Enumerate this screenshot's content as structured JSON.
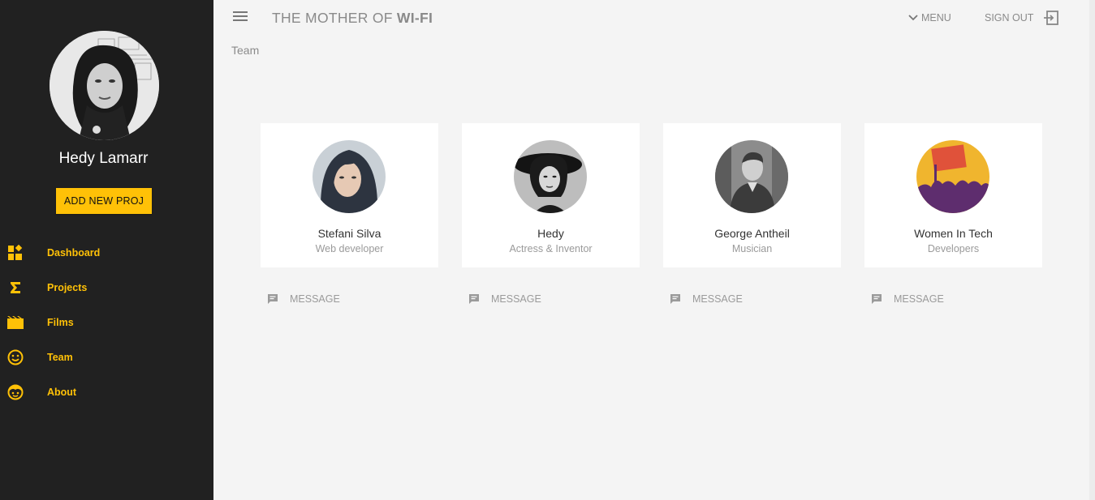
{
  "header": {
    "title_prefix": "THE MOTHER OF ",
    "title_bold": "WI-FI",
    "menu_label": "MENU",
    "signout_label": "SIGN OUT"
  },
  "sidebar": {
    "profile_name": "Hedy Lamarr",
    "add_button_label": "ADD NEW PROJ",
    "items": [
      {
        "label": "Dashboard",
        "icon": "dashboard-icon"
      },
      {
        "label": "Projects",
        "icon": "sigma-icon"
      },
      {
        "label": "Films",
        "icon": "film-icon"
      },
      {
        "label": "Team",
        "icon": "smiley-icon"
      },
      {
        "label": "About",
        "icon": "face-icon"
      }
    ]
  },
  "main": {
    "heading": "Team",
    "members": [
      {
        "name": "Stefani Silva",
        "role": "Web developer",
        "message_label": "MESSAGE"
      },
      {
        "name": "Hedy",
        "role": "Actress & Inventor",
        "message_label": "MESSAGE"
      },
      {
        "name": "George Antheil",
        "role": "Musician",
        "message_label": "MESSAGE"
      },
      {
        "name": "Women In Tech",
        "role": "Developers",
        "message_label": "MESSAGE"
      }
    ]
  },
  "colors": {
    "accent": "#ffc107",
    "sidebar_bg": "#212121",
    "page_bg": "#f4f4f4"
  }
}
